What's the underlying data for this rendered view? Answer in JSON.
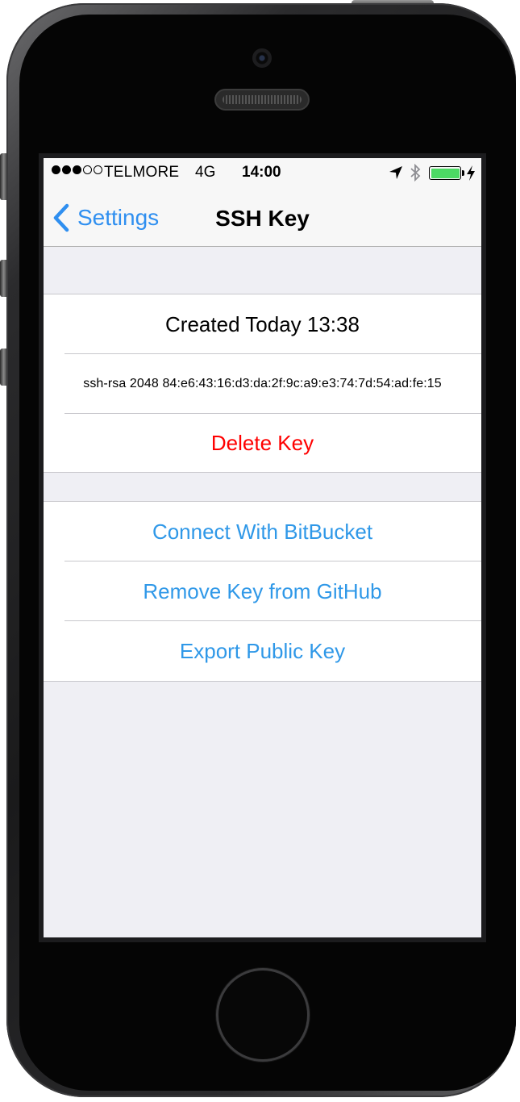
{
  "statusbar": {
    "signal_dots": [
      true,
      true,
      true,
      false,
      false
    ],
    "carrier": "TELMORE",
    "network": "4G",
    "time": "14:00",
    "icons": [
      "location-arrow-icon",
      "bluetooth-icon",
      "battery-icon",
      "charging-bolt-icon"
    ],
    "battery_level": 1.0,
    "battery_color": "#4cd964"
  },
  "navbar": {
    "back_label": "Settings",
    "title": "SSH Key",
    "tint_color": "#2f8ff0"
  },
  "key_section": {
    "created": "Created Today 13:38",
    "fingerprint": "ssh-rsa 2048 84:e6:43:16:d3:da:2f:9c:a9:e3:74:7d:54:ad:fe:15",
    "delete_label": "Delete Key",
    "delete_color": "#ff0000"
  },
  "actions_section": {
    "items": [
      {
        "label": "Connect With BitBucket"
      },
      {
        "label": "Remove Key from GitHub"
      },
      {
        "label": "Export Public Key"
      }
    ],
    "action_color": "#2f98e8"
  }
}
